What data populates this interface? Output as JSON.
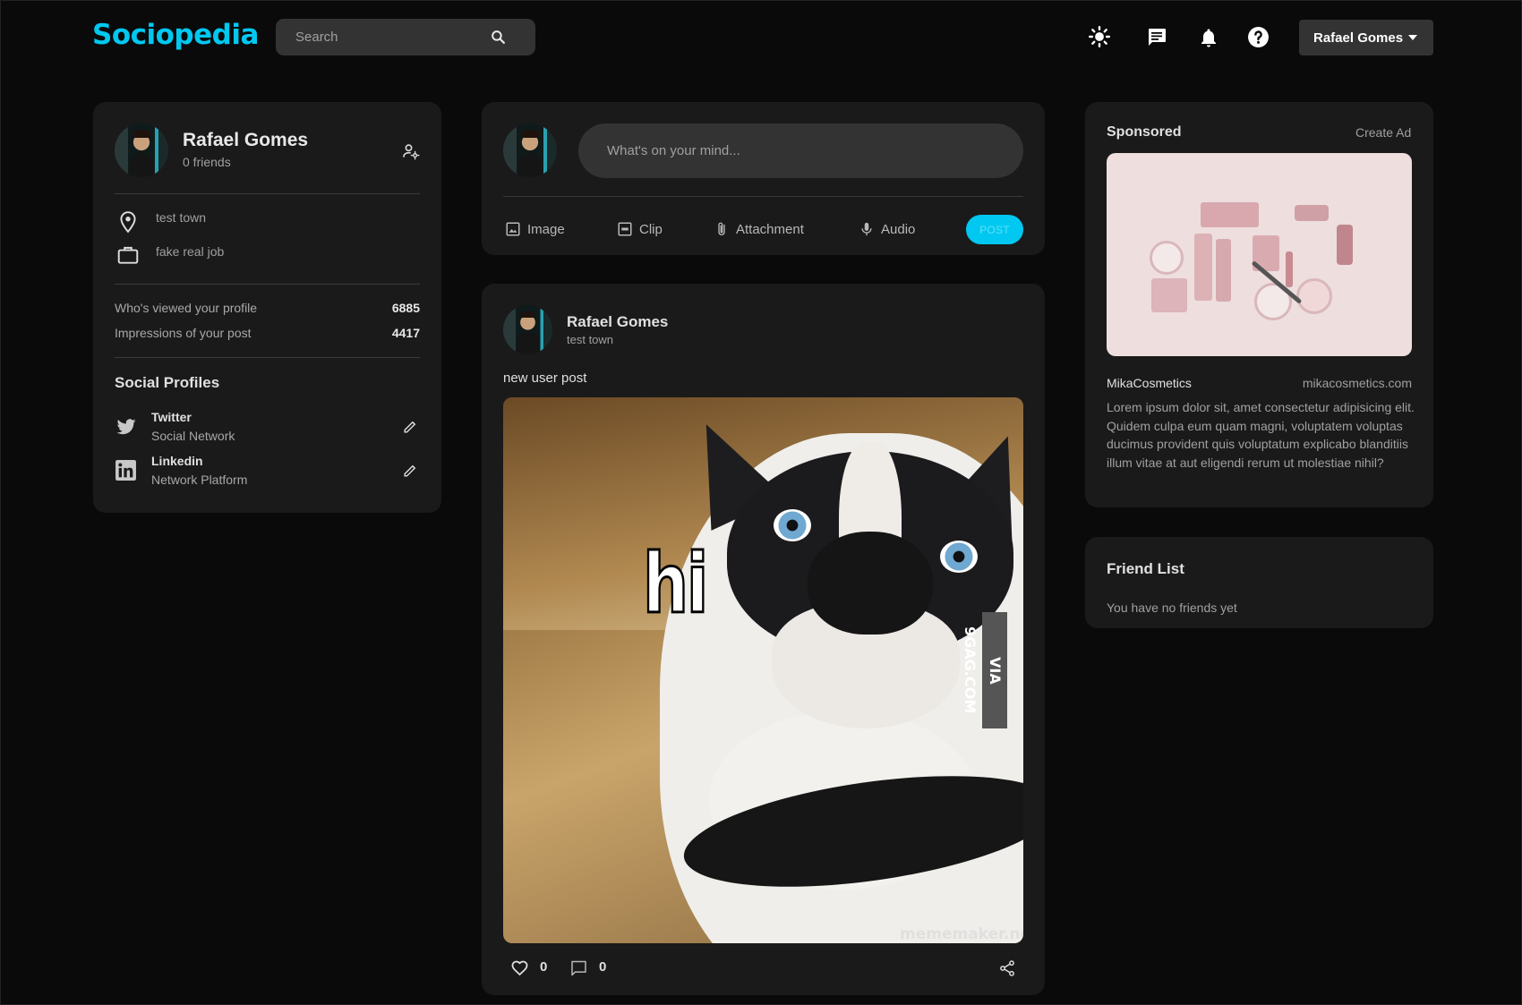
{
  "app": {
    "logo": "Sociopedia"
  },
  "header": {
    "search_placeholder": "Search",
    "user_name": "Rafael Gomes",
    "icons": [
      "light-mode-icon",
      "message-icon",
      "notifications-icon",
      "help-icon",
      "search-icon"
    ]
  },
  "user_card": {
    "name": "Rafael Gomes",
    "friends": "0 friends",
    "location": "test town",
    "occupation": "fake real job",
    "stats": [
      {
        "label": "Who's viewed your profile",
        "value": "6885"
      },
      {
        "label": "Impressions of your post",
        "value": "4417"
      }
    ],
    "social_title": "Social Profiles",
    "social": [
      {
        "name": "Twitter",
        "sub": "Social Network"
      },
      {
        "name": "Linkedin",
        "sub": "Network Platform"
      }
    ]
  },
  "composer": {
    "placeholder": "What's on your mind...",
    "tools": [
      "Image",
      "Clip",
      "Attachment",
      "Audio"
    ],
    "post_label": "POST"
  },
  "post": {
    "author": "Rafael Gomes",
    "location": "test town",
    "text": "new user post",
    "image_caption": "hi",
    "watermark_9gag": "VIA 9GAG.COM",
    "watermark_mm": "mememaker.ne",
    "likes": "0",
    "comments": "0"
  },
  "sponsored": {
    "title": "Sponsored",
    "create_ad": "Create Ad",
    "brand": "MikaCosmetics",
    "url": "mikacosmetics.com",
    "description": "Lorem ipsum dolor sit, amet consectetur adipisicing elit. Quidem culpa eum quam magni, voluptatem voluptas ducimus provident quis voluptatum explicabo blanditiis illum vitae at aut eligendi rerum ut molestiae nihil?"
  },
  "friend_list": {
    "title": "Friend List",
    "empty": "You have no friends yet"
  },
  "colors": {
    "accent": "#00c8f0",
    "background": "#0a0a0a",
    "card": "#1a1a1a",
    "input": "#333333"
  }
}
